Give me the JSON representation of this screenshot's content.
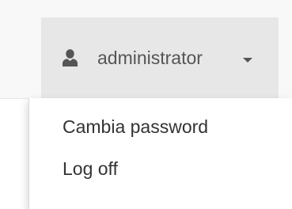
{
  "navbar": {
    "user": {
      "name": "administrator",
      "icon": "user-icon"
    },
    "dropdown": {
      "items": [
        {
          "label": "Cambia password"
        },
        {
          "label": "Log off"
        }
      ]
    }
  },
  "colors": {
    "navbar_bg": "#f8f8f8",
    "toggle_active_bg": "#e7e7e7",
    "text": "#555555",
    "menu_text": "#333333"
  }
}
